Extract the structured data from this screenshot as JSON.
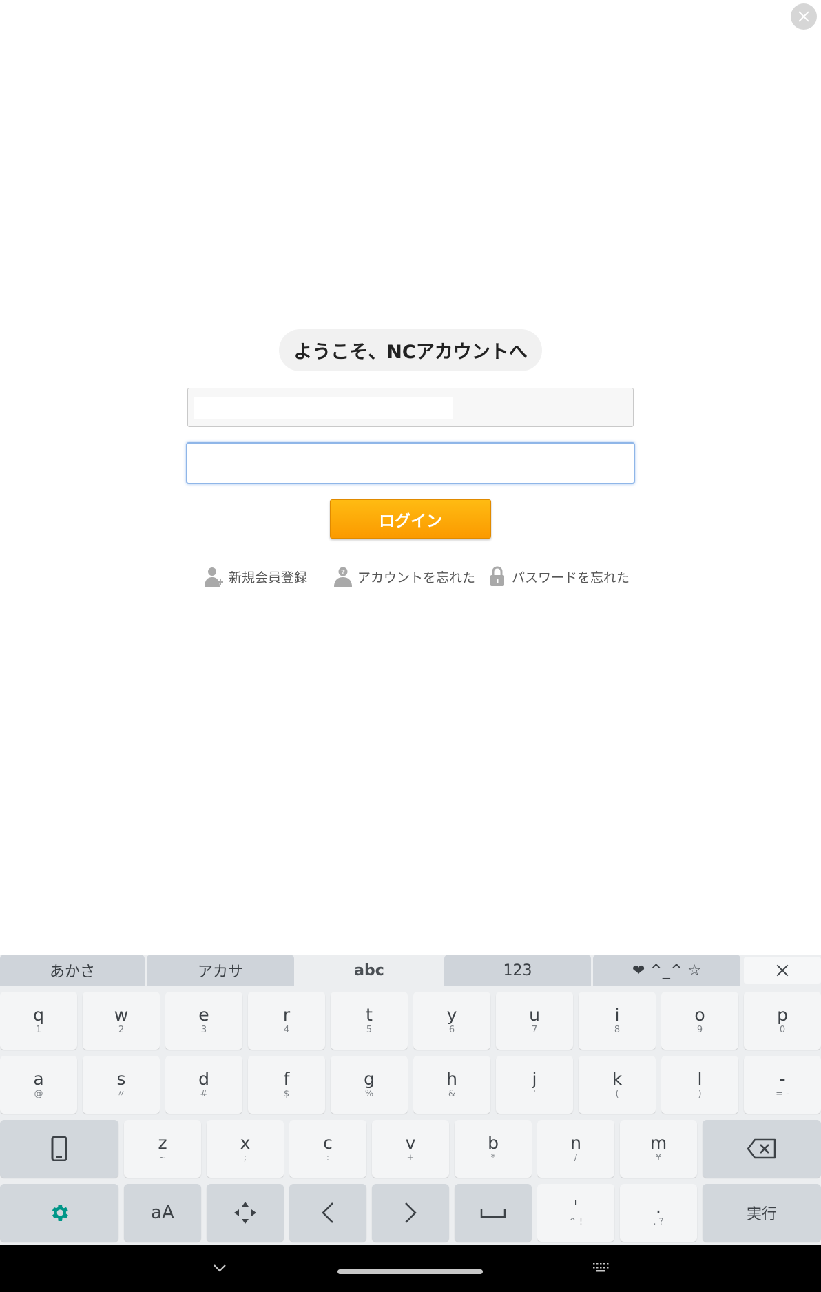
{
  "page": {
    "title": "ようこそ、NCアカウントへ"
  },
  "form": {
    "account_value": "",
    "password_value": "",
    "login_label": "ログイン"
  },
  "links": [
    {
      "label": "新規会員登録",
      "icon": "person-add-icon"
    },
    {
      "label": "アカウントを忘れた",
      "icon": "person-question-icon"
    },
    {
      "label": "パスワードを忘れた",
      "icon": "lock-icon"
    }
  ],
  "keyboard": {
    "tabs": [
      "あかさ",
      "アカサ",
      "abc",
      "123",
      "❤ ^_^ ☆"
    ],
    "active_tab": "abc",
    "row1": [
      {
        "main": "q",
        "sub": "1"
      },
      {
        "main": "w",
        "sub": "2"
      },
      {
        "main": "e",
        "sub": "3"
      },
      {
        "main": "r",
        "sub": "4"
      },
      {
        "main": "t",
        "sub": "5"
      },
      {
        "main": "y",
        "sub": "6"
      },
      {
        "main": "u",
        "sub": "7"
      },
      {
        "main": "i",
        "sub": "8"
      },
      {
        "main": "o",
        "sub": "9"
      },
      {
        "main": "p",
        "sub": "0"
      }
    ],
    "row2": [
      {
        "main": "a",
        "sub": "@"
      },
      {
        "main": "s",
        "sub": "〃"
      },
      {
        "main": "d",
        "sub": "#"
      },
      {
        "main": "f",
        "sub": "$"
      },
      {
        "main": "g",
        "sub": "%"
      },
      {
        "main": "h",
        "sub": "&"
      },
      {
        "main": "j",
        "sub": "'"
      },
      {
        "main": "k",
        "sub": "("
      },
      {
        "main": "l",
        "sub": ")"
      },
      {
        "main": "-",
        "sub": "= -"
      }
    ],
    "row3": [
      {
        "main": "z",
        "sub": "~"
      },
      {
        "main": "x",
        "sub": ";"
      },
      {
        "main": "c",
        "sub": ":"
      },
      {
        "main": "v",
        "sub": "+"
      },
      {
        "main": "b",
        "sub": "*"
      },
      {
        "main": "n",
        "sub": "/"
      },
      {
        "main": "m",
        "sub": "¥"
      }
    ],
    "row4": {
      "case_label": "aA",
      "comma": {
        "main": "'",
        "sub": "^ !"
      },
      "period": {
        "main": ".",
        "sub": ". ?"
      },
      "enter_label": "実行"
    },
    "accent_color": "#009688"
  }
}
